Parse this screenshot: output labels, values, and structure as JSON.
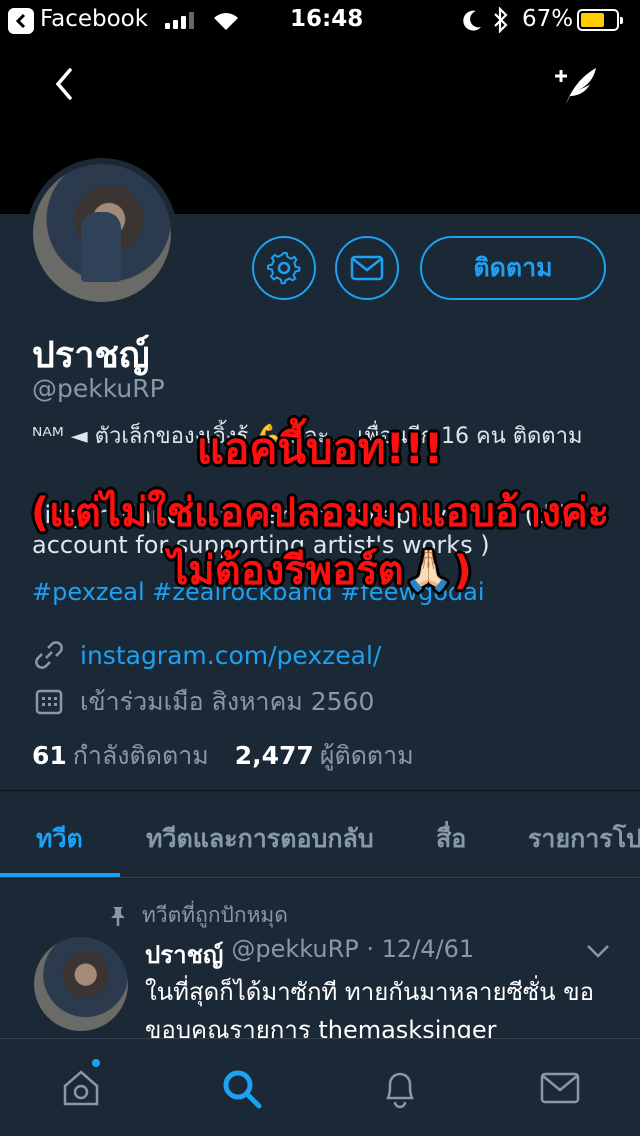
{
  "status_bar": {
    "back_app": "Facebook",
    "time": "16:48",
    "battery": "67%",
    "battery_level": 0.67
  },
  "header": {
    "back_icon": "chevron-left-icon",
    "compose_icon": "compose-tweet-icon"
  },
  "profile": {
    "settings_icon": "gear-icon",
    "message_icon": "envelope-icon",
    "follow_label": "ติดตาม",
    "name": "ปราชญ์",
    "handle": "@pekkuRP",
    "bio_line1": "ᴺᴬᴹ ◄ ตัวเล็กของงเจิ้งร้ 💪 และ... เพื่อนอีก 16 คน ติดตาม",
    "bio_line2": "singer, dancer, writer and roleplayer . . . (this account for supporting artist's works )",
    "hashtags": "#pexzeal #zealrockband #feewgodai",
    "link": "instagram.com/pexzeal/",
    "joined": "เข้าร่วมเมือ สิงหาคม 2560",
    "following_count": "61",
    "following_label": "กำลังติดตาม",
    "followers_count": "2,477",
    "followers_label": "ผู้ติดตาม"
  },
  "tabs": [
    {
      "label": "ทวีต",
      "active": true
    },
    {
      "label": "ทวีตและการตอบกลับ",
      "active": false
    },
    {
      "label": "สื่อ",
      "active": false
    },
    {
      "label": "รายการโปรด",
      "active": false
    }
  ],
  "tweet": {
    "pinned_label": "ทวีตที่ถูกปักหมุด",
    "name": "ปราชญ์",
    "handle_date": "@pekkuRP · 12/4/61",
    "text": "ในที่สุดก็ได้มาซักที ทายกันมาหลายซีซั่น ขอขอบคุณรายการ themasksinger"
  },
  "bottom_nav": [
    "home-icon",
    "search-icon",
    "notifications-bell-icon",
    "messages-envelope-icon"
  ],
  "overlay": {
    "line1": "แอคนี้บอท!!!",
    "line2": "(แต่ไม่ใช่แอคปลอมมาแอบอ้างค่ะ",
    "line3": "ไม่ต้องรีพอร์ต🙏🏻)"
  },
  "colors": {
    "accent": "#1da1f2",
    "background": "#141d26",
    "card": "#1b2836",
    "muted": "#8899a6",
    "overlay_red": "#ff1010"
  }
}
